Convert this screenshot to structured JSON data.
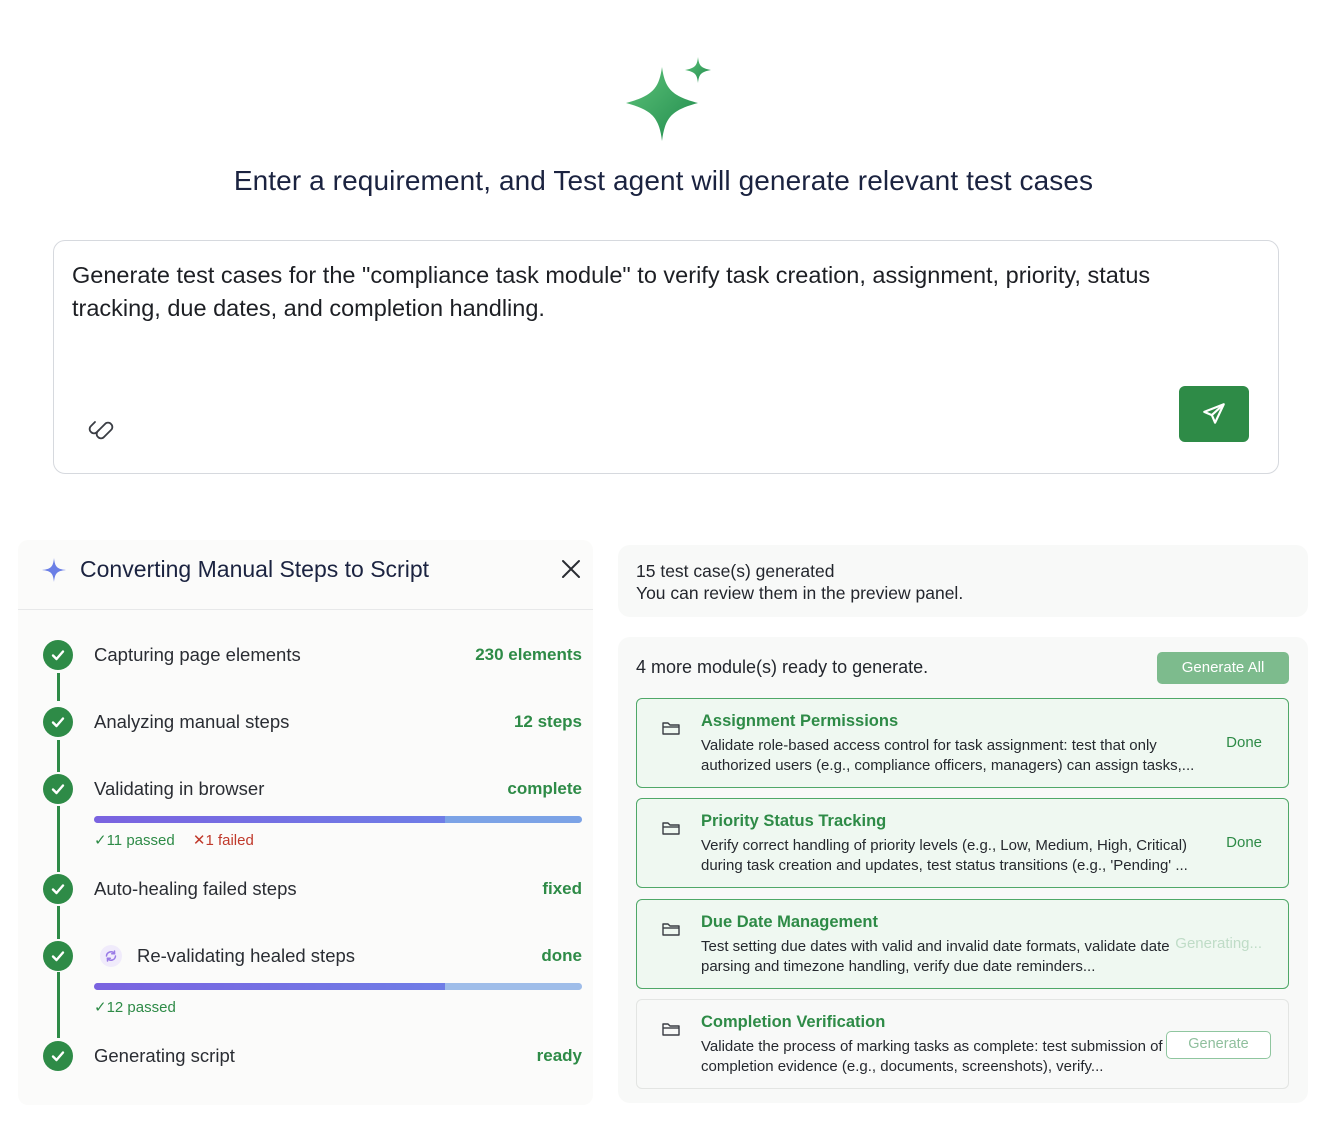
{
  "hero": {
    "title": "Enter a requirement, and Test agent will generate relevant test cases"
  },
  "prompt": {
    "text": "Generate test cases for the \"compliance task module\" to verify task creation, assignment, priority, status tracking, due dates, and completion handling.",
    "attach_icon": "paperclip-icon",
    "send_icon": "send-icon"
  },
  "conversion": {
    "title": "Converting Manual Steps to Script",
    "steps": [
      {
        "label": "Capturing page elements",
        "value": "230 elements"
      },
      {
        "label": "Analyzing manual steps",
        "value": "12 steps"
      },
      {
        "label": "Validating in browser",
        "value": "complete",
        "passed": "11 passed",
        "failed": "1 failed",
        "progress": 0.72
      },
      {
        "label": "Auto-healing failed steps",
        "value": "fixed"
      },
      {
        "label": "Re-validating healed steps",
        "value": "done",
        "passed": "12 passed",
        "progress": 0.72
      },
      {
        "label": "Generating script",
        "value": "ready"
      }
    ]
  },
  "summary": {
    "line1": "15 test case(s) generated",
    "line2": "You can review them in the preview panel."
  },
  "modules": {
    "heading": "4 more module(s) ready to generate.",
    "generate_all": "Generate All",
    "items": [
      {
        "title": "Assignment Permissions",
        "desc": "Validate role-based access control for task assignment: test that only authorized users (e.g., compliance officers, managers) can assign tasks,...",
        "status": "Done"
      },
      {
        "title": "Priority Status Tracking",
        "desc": "Verify correct handling of priority levels (e.g., Low, Medium, High, Critical) during task creation and updates, test status transitions (e.g., 'Pending' ...",
        "status": "Done"
      },
      {
        "title": "Due Date Management",
        "desc": "Test setting due dates with valid and invalid date formats, validate date parsing and timezone handling, verify due date reminders...",
        "status": "Generating..."
      },
      {
        "title": "Completion Verification",
        "desc": "Validate the process of marking tasks as complete: test submission of completion evidence (e.g., documents, screenshots), verify...",
        "button": "Generate"
      }
    ]
  },
  "colors": {
    "accent_green": "#2e8b47",
    "fail_red": "#c0392b",
    "progress_purple": "#7a63e0"
  }
}
